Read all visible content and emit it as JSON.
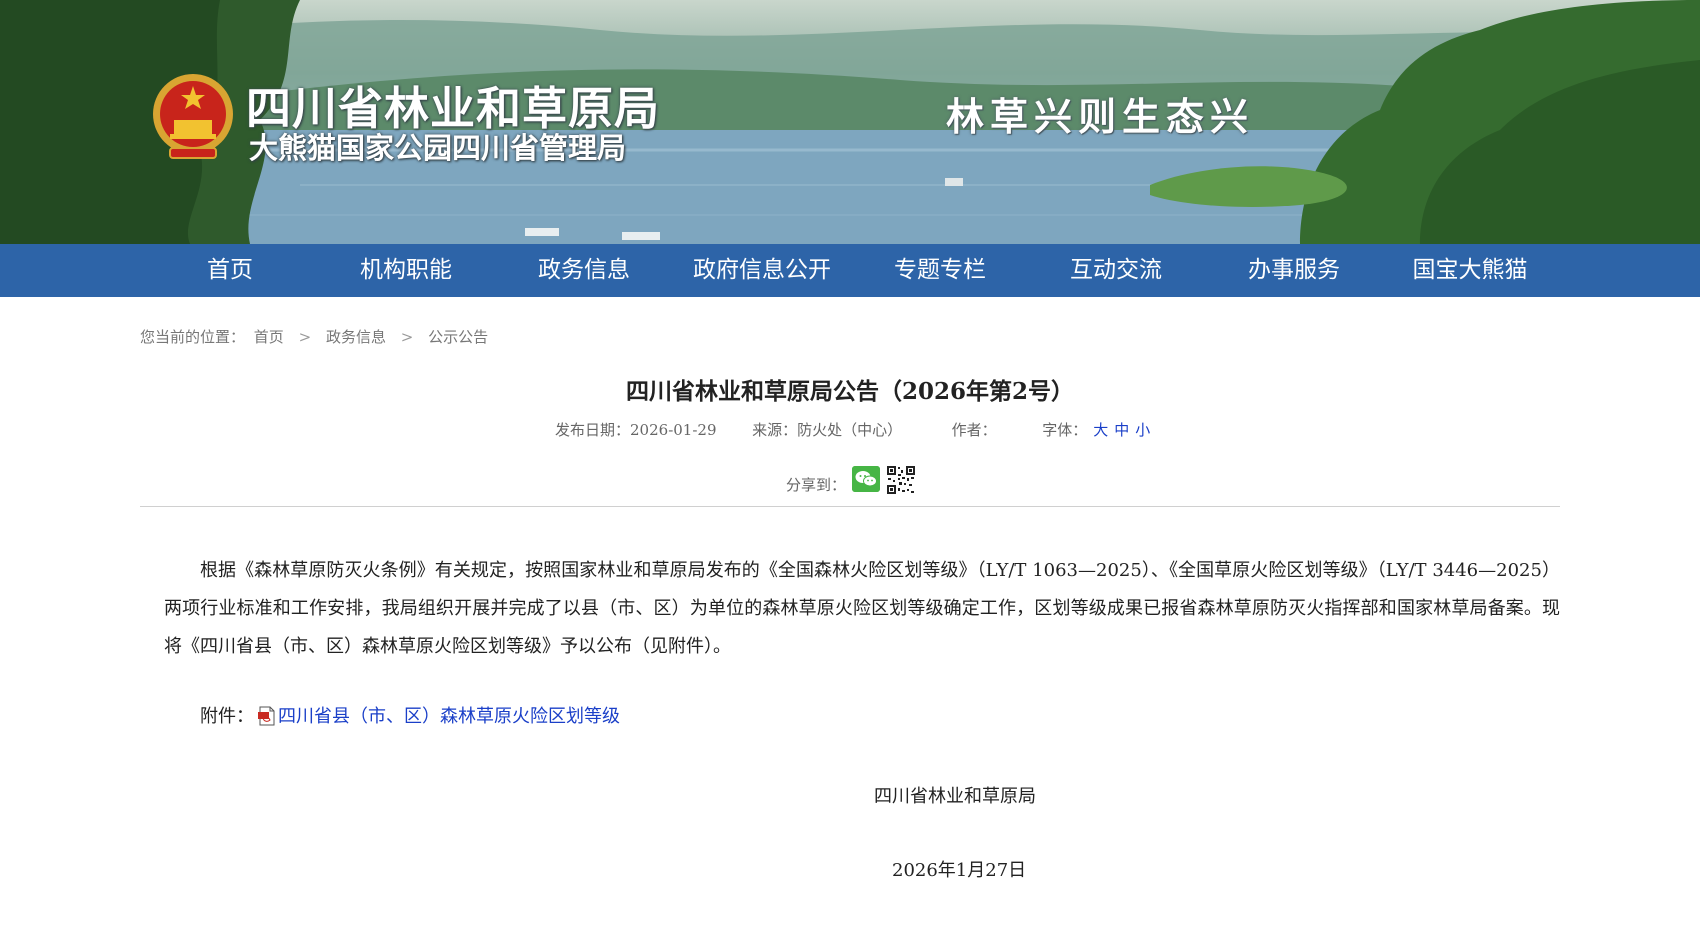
{
  "header": {
    "site_name": "四川省林业和草原局",
    "site_subname": "大熊猫国家公园四川省管理局",
    "slogan": "林草兴则生态兴"
  },
  "nav": {
    "items": [
      "首页",
      "机构职能",
      "政务信息",
      "政府信息公开",
      "专题专栏",
      "互动交流",
      "办事服务",
      "国宝大熊猫"
    ]
  },
  "breadcrumb": {
    "label": "您当前的位置：",
    "items": [
      "首页",
      "政务信息",
      "公示公告"
    ],
    "separator": ">"
  },
  "article": {
    "title": "四川省林业和草原局公告（2026年第2号）",
    "publish_label": "发布日期：",
    "publish_date": "2026-01-29",
    "source_label": "来源：",
    "source": "防火处（中心）",
    "author_label": "作者：",
    "font_label": "字体：",
    "font_sizes": [
      "大",
      "中",
      "小"
    ],
    "share_label": "分享到：",
    "body": "根据《森林草原防灭火条例》有关规定，按照国家林业和草原局发布的《全国森林火险区划等级》（LY/T 1063—2025）、《全国草原火险区划等级》（LY/T 3446—2025）两项行业标准和工作安排，我局组织开展并完成了以县（市、区）为单位的森林草原火险区划等级确定工作，区划等级成果已报省森林草原防灭火指挥部和国家林草局备案。现将《四川省县（市、区）森林草原火险区划等级》予以公布（见附件）。",
    "attachment_label": "附件：",
    "attachment_link": "四川省县（市、区）森林草原火险区划等级",
    "signature": "四川省林业和草原局",
    "sign_date": "2026年1月27日"
  },
  "colors": {
    "nav_bg": "#2d64a8",
    "link": "#1a3fc8",
    "wechat": "#46b545"
  }
}
